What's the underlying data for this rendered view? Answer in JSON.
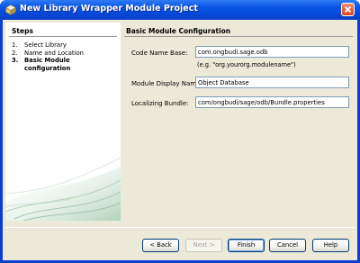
{
  "window": {
    "title": "New Library Wrapper Module Project"
  },
  "steps": {
    "title": "Steps",
    "items": [
      {
        "num": "1.",
        "label": "Select Library",
        "current": false
      },
      {
        "num": "2.",
        "label": "Name and Location",
        "current": false
      },
      {
        "num": "3.",
        "label": "Basic Module configuration",
        "current": true
      }
    ]
  },
  "content": {
    "title": "Basic Module Configuration",
    "code_name_base": {
      "label": "Code Name Base:",
      "value": "com.ongbudi.sage.odb",
      "hint": "(e.g. \"org.yourorg.modulename\")"
    },
    "module_display_name": {
      "label": "Module Display Name:",
      "value": "Object Database"
    },
    "localizing_bundle": {
      "label": "Localizing Bundle:",
      "value": "com/ongbudi/sage/odb/Bundle.properties"
    }
  },
  "buttons": {
    "back": "< Back",
    "next": "Next >",
    "finish": "Finish",
    "cancel": "Cancel",
    "help": "Help"
  },
  "colors": {
    "titlebar": "#0b56e6",
    "dialog_bg": "#ece9d8",
    "input_border": "#7f9db9"
  }
}
